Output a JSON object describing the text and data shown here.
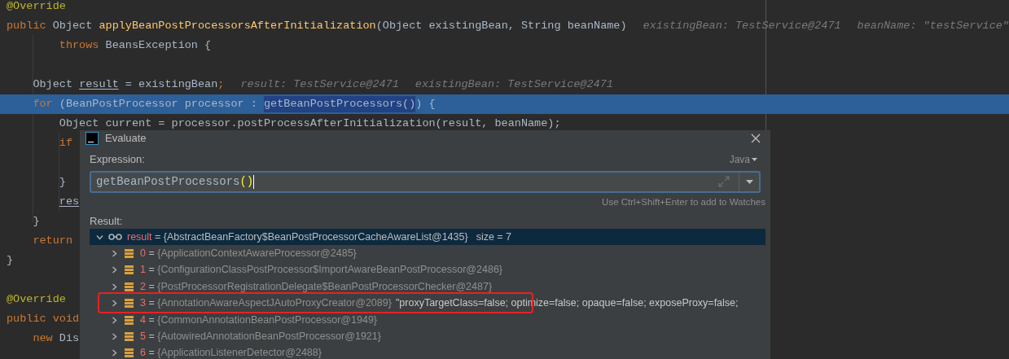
{
  "editor": {
    "lines": [
      {
        "selected": false,
        "tokens": [
          {
            "kind": "annotation",
            "text": "@Override"
          }
        ]
      },
      {
        "selected": false,
        "tokens": [
          {
            "kind": "keyword",
            "text": "public"
          },
          {
            "kind": "plain",
            "text": " Object "
          },
          {
            "kind": "method",
            "text": "applyBeanPostProcessorsAfterInitialization"
          },
          {
            "kind": "plain",
            "text": "(Object existingBean, String beanName)"
          },
          {
            "kind": "hint",
            "text": "existingBean: TestService@2471"
          },
          {
            "kind": "hint",
            "text": "beanName: \"testService\""
          }
        ]
      },
      {
        "selected": false,
        "tokens": [
          {
            "kind": "keyword",
            "text": "        throws"
          },
          {
            "kind": "plain",
            "text": " BeansException {"
          }
        ]
      },
      {
        "selected": false
      },
      {
        "selected": false,
        "tokens": [
          {
            "kind": "plain",
            "text": "    Object "
          },
          {
            "kind": "variable",
            "text": "result"
          },
          {
            "kind": "plain",
            "text": " = existingBean"
          },
          {
            "kind": "keyword",
            "text": ";"
          },
          {
            "kind": "hint",
            "text": "result: TestService@2471"
          },
          {
            "kind": "hint",
            "text": "existingBean: TestService@2471"
          }
        ]
      },
      {
        "selected": true,
        "tokens": [
          {
            "kind": "keyword",
            "text": "    for"
          },
          {
            "kind": "plain",
            "text": " (BeanPostProcessor processor : "
          },
          {
            "kind": "match",
            "text": "getBeanPostProcessors()"
          },
          {
            "kind": "plain",
            "text": ") {"
          }
        ]
      },
      {
        "selected": false,
        "tokens": [
          {
            "kind": "plain",
            "text": "        Object current = processor.postProcessAfterInitialization(result, beanName);"
          }
        ]
      },
      {
        "selected": false,
        "tokens": [
          {
            "kind": "keyword",
            "text": "        if"
          }
        ]
      },
      {
        "selected": false
      },
      {
        "selected": false,
        "tokens": [
          {
            "kind": "plain",
            "text": "        }"
          }
        ]
      },
      {
        "selected": false,
        "tokens": [
          {
            "kind": "variable",
            "text": "        res"
          }
        ]
      },
      {
        "selected": false,
        "tokens": [
          {
            "kind": "plain",
            "text": "    }"
          }
        ]
      },
      {
        "selected": false,
        "tokens": [
          {
            "kind": "keyword",
            "text": "    return"
          }
        ]
      },
      {
        "selected": false,
        "tokens": [
          {
            "kind": "plain",
            "text": "}"
          }
        ]
      },
      {
        "selected": false
      },
      {
        "selected": false,
        "tokens": [
          {
            "kind": "annotation",
            "text": "@Override"
          }
        ]
      },
      {
        "selected": false,
        "tokens": [
          {
            "kind": "keyword",
            "text": "public"
          },
          {
            "kind": "keyword",
            "text": " void"
          }
        ]
      },
      {
        "selected": false,
        "tokens": [
          {
            "kind": "keyword",
            "text": "    new"
          },
          {
            "kind": "plain",
            "text": " Dis"
          }
        ]
      }
    ]
  },
  "dialog": {
    "title": "Evaluate",
    "expression_label": "Expression:",
    "language": "Java",
    "expression": {
      "value": "getBeanPostProcessors",
      "parens": "()"
    },
    "hint": "Use Ctrl+Shift+Enter to add to Watches",
    "result_label": "Result:",
    "result": {
      "name": "result",
      "separator": "=",
      "value": "{AbstractBeanFactory$BeanPostProcessorCacheAwareList@1435}",
      "extra": "size = 7",
      "expanded": true,
      "selected": true,
      "children": [
        {
          "name": "0",
          "separator": "=",
          "value": "{ApplicationContextAwareProcessor@2485}",
          "expanded": false,
          "marked": false
        },
        {
          "name": "1",
          "separator": "=",
          "value": "{ConfigurationClassPostProcessor$ImportAwareBeanPostProcessor@2486}",
          "expanded": false,
          "marked": false
        },
        {
          "name": "2",
          "separator": "=",
          "value": "{PostProcessorRegistrationDelegate$BeanPostProcessorChecker@2487}",
          "expanded": false,
          "marked": false
        },
        {
          "name": "3",
          "separator": "=",
          "value": "{AnnotationAwareAspectJAutoProxyCreator@2089}",
          "description": "\"proxyTargetClass=false; optimize=false; opaque=false; exposeProxy=false;",
          "expanded": false,
          "marked": true
        },
        {
          "name": "4",
          "separator": "=",
          "value": "{CommonAnnotationBeanPostProcessor@1949}",
          "expanded": false,
          "marked": false
        },
        {
          "name": "5",
          "separator": "=",
          "value": "{AutowiredAnnotationBeanPostProcessor@1921}",
          "expanded": false,
          "marked": false
        },
        {
          "name": "6",
          "separator": "=",
          "value": "{ApplicationListenerDetector@2488}",
          "expanded": false,
          "marked": false
        }
      ]
    }
  }
}
